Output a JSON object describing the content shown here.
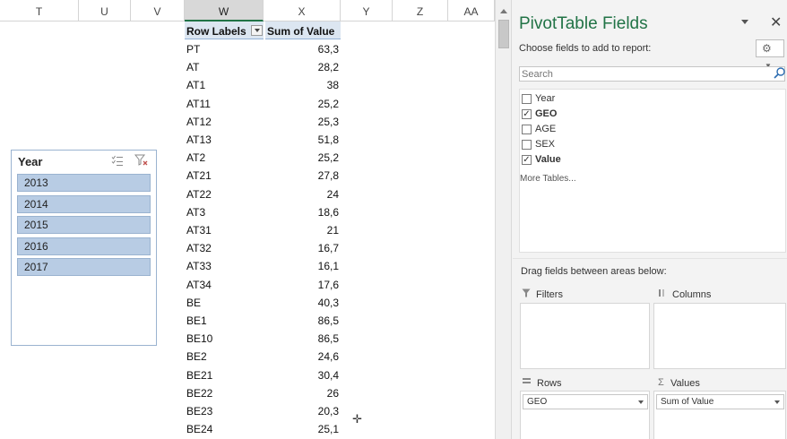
{
  "spreadsheet": {
    "columns": [
      "T",
      "U",
      "V",
      "W",
      "X",
      "Y",
      "Z",
      "AA"
    ],
    "pivot": {
      "header_row_labels": "Row Labels",
      "header_sum": "Sum of Value",
      "rows": [
        {
          "label": "PT",
          "value": "63,3"
        },
        {
          "label": "AT",
          "value": "28,2"
        },
        {
          "label": "AT1",
          "value": "38"
        },
        {
          "label": "AT11",
          "value": "25,2"
        },
        {
          "label": "AT12",
          "value": "25,3"
        },
        {
          "label": "AT13",
          "value": "51,8"
        },
        {
          "label": "AT2",
          "value": "25,2"
        },
        {
          "label": "AT21",
          "value": "27,8"
        },
        {
          "label": "AT22",
          "value": "24"
        },
        {
          "label": "AT3",
          "value": "18,6"
        },
        {
          "label": "AT31",
          "value": "21"
        },
        {
          "label": "AT32",
          "value": "16,7"
        },
        {
          "label": "AT33",
          "value": "16,1"
        },
        {
          "label": "AT34",
          "value": "17,6"
        },
        {
          "label": "BE",
          "value": "40,3"
        },
        {
          "label": "BE1",
          "value": "86,5"
        },
        {
          "label": "BE10",
          "value": "86,5"
        },
        {
          "label": "BE2",
          "value": "24,6"
        },
        {
          "label": "BE21",
          "value": "30,4"
        },
        {
          "label": "BE22",
          "value": "26"
        },
        {
          "label": "BE23",
          "value": "20,3"
        },
        {
          "label": "BE24",
          "value": "25,1"
        }
      ]
    },
    "slicer": {
      "title": "Year",
      "items": [
        "2013",
        "2014",
        "2015",
        "2016",
        "2017"
      ]
    }
  },
  "pane": {
    "title": "PivotTable Fields",
    "choose_label": "Choose fields to add to report:",
    "search_placeholder": "Search",
    "fields": [
      {
        "name": "Year",
        "checked": false
      },
      {
        "name": "GEO",
        "checked": true
      },
      {
        "name": "AGE",
        "checked": false
      },
      {
        "name": "SEX",
        "checked": false
      },
      {
        "name": "Value",
        "checked": true
      }
    ],
    "more_tables": "More Tables...",
    "drag_label": "Drag fields between areas below:",
    "areas": {
      "filters": "Filters",
      "columns": "Columns",
      "rows": "Rows",
      "values": "Values",
      "rows_item": "GEO",
      "values_item": "Sum of Value"
    }
  },
  "colors": {
    "accent": "#217346",
    "pivot_header_bg": "#dce6f1",
    "slicer_item_bg": "#b8cce4"
  }
}
